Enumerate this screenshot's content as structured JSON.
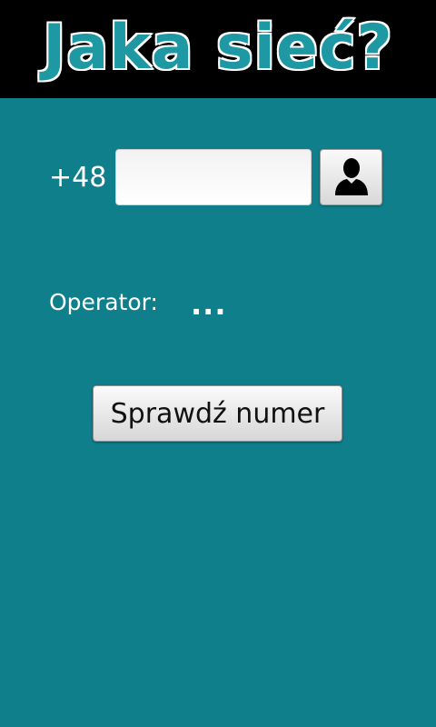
{
  "header": {
    "title": "Jaka sieć?"
  },
  "form": {
    "prefix": "+48",
    "phone_value": "",
    "phone_placeholder": "",
    "contacts_icon": "person-icon",
    "operator_label": "Operator:",
    "operator_value": "...",
    "check_button_label": "Sprawdź numer"
  },
  "colors": {
    "background": "#0f7f8c",
    "header_background": "#000000",
    "title_fill": "#1e99a4",
    "title_outline": "#ffffff"
  }
}
